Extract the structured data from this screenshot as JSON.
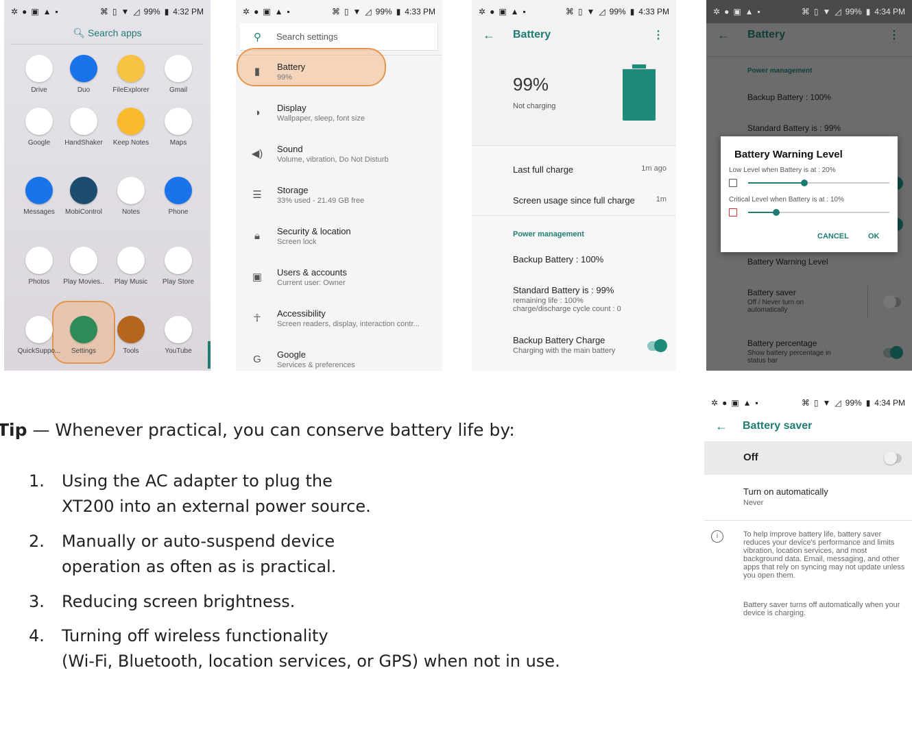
{
  "status_bars": [
    {
      "battery": "99%",
      "time": "4:32 PM"
    },
    {
      "battery": "99%",
      "time": "4:33 PM"
    },
    {
      "battery": "99%",
      "time": "4:33 PM"
    },
    {
      "battery": "99%",
      "time": "4:34 PM"
    },
    {
      "battery": "99%",
      "time": "4:34 PM"
    }
  ],
  "launcher": {
    "search_label": "Search apps",
    "rows": [
      [
        {
          "label": "Drive",
          "icon": "drive-icon",
          "color": "#ffffff"
        },
        {
          "label": "Duo",
          "icon": "duo-icon",
          "color": "#1a73e8"
        },
        {
          "label": "FileExplorer",
          "icon": "file-explorer-icon",
          "color": "#f6c343"
        },
        {
          "label": "Gmail",
          "icon": "gmail-icon",
          "color": "#ffffff"
        }
      ],
      [
        {
          "label": "Google",
          "icon": "google-icon",
          "color": "#ffffff"
        },
        {
          "label": "HandShaker",
          "icon": "handshaker-icon",
          "color": "#ffffff"
        },
        {
          "label": "Keep Notes",
          "icon": "keep-notes-icon",
          "color": "#f9bb2d"
        },
        {
          "label": "Maps",
          "icon": "maps-icon",
          "color": "#ffffff"
        }
      ],
      [
        {
          "label": "Messages",
          "icon": "messages-icon",
          "color": "#1a73e8"
        },
        {
          "label": "MobiControl",
          "icon": "mobicontrol-icon",
          "color": "#1d4d6e"
        },
        {
          "label": "Notes",
          "icon": "notes-icon",
          "color": "#ffffff"
        },
        {
          "label": "Phone",
          "icon": "phone-icon",
          "color": "#1a73e8"
        }
      ],
      [
        {
          "label": "Photos",
          "icon": "photos-icon",
          "color": "#ffffff"
        },
        {
          "label": "Play Movies..",
          "icon": "play-movies-icon",
          "color": "#ffffff"
        },
        {
          "label": "Play Music",
          "icon": "play-music-icon",
          "color": "#ffffff"
        },
        {
          "label": "Play Store",
          "icon": "play-store-icon",
          "color": "#ffffff"
        }
      ],
      [
        {
          "label": "QuickSuppo...",
          "icon": "quicksupport-icon",
          "color": "#ffffff"
        },
        {
          "label": "Settings",
          "icon": "settings-gear-icon",
          "color": "#2e8b57"
        },
        {
          "label": "Tools",
          "icon": "tools-icon",
          "color": "#b5651d"
        },
        {
          "label": "YouTube",
          "icon": "youtube-icon",
          "color": "#ffffff"
        }
      ]
    ]
  },
  "settings": {
    "search_placeholder": "Search settings",
    "items": [
      {
        "title": "Battery",
        "subtitle": "99%",
        "icon": "battery-icon"
      },
      {
        "title": "Display",
        "subtitle": "Wallpaper, sleep, font size",
        "icon": "brightness-icon"
      },
      {
        "title": "Sound",
        "subtitle": "Volume, vibration, Do Not Disturb",
        "icon": "speaker-icon"
      },
      {
        "title": "Storage",
        "subtitle": "33% used - 21.49 GB free",
        "icon": "storage-icon"
      },
      {
        "title": "Security & location",
        "subtitle": "Screen lock",
        "icon": "lock-icon"
      },
      {
        "title": "Users & accounts",
        "subtitle": "Current user: Owner",
        "icon": "account-icon"
      },
      {
        "title": "Accessibility",
        "subtitle": "Screen readers, display, interaction contr...",
        "icon": "accessibility-icon"
      },
      {
        "title": "Google",
        "subtitle": "Services & preferences",
        "icon": "google-g-icon"
      }
    ]
  },
  "battery_screen": {
    "title": "Battery",
    "percent": "99%",
    "status": "Not charging",
    "last_full_charge_label": "Last full charge",
    "last_full_charge_value": "1m ago",
    "screen_usage_label": "Screen usage since full charge",
    "screen_usage_value": "1m",
    "section": "Power management",
    "backup_battery": "Backup Battery : 100%",
    "standard_battery": "Standard Battery is : 99%",
    "remaining_life": "remaining life : 100%",
    "cycle_count": "charge/discharge cycle count : 0",
    "backup_charge_title": "Backup Battery Charge",
    "backup_charge_sub": "Charging with the main battery",
    "battery_fill_level": 0.99,
    "accent": "#1e7c73"
  },
  "warning_screen": {
    "title": "Battery",
    "section": "Power management",
    "backup_battery": "Backup Battery : 100%",
    "standard_battery": "Standard Battery is : 99%",
    "warning_level": "Battery Warning Level",
    "saver_title": "Battery saver",
    "saver_sub": "Off / Never turn on automatically",
    "percentage_title": "Battery percentage",
    "percentage_sub": "Show battery percentage in status bar",
    "dialog": {
      "title": "Battery Warning Level",
      "low_label": "Low Level when Battery is at : 20%",
      "low_value": 0.2,
      "critical_label": "Critical Level when Battery is at : 10%",
      "critical_value": 0.1,
      "cancel": "CANCEL",
      "ok": "OK"
    }
  },
  "saver_screen": {
    "title": "Battery saver",
    "state": "Off",
    "auto_title": "Turn on automatically",
    "auto_value": "Never",
    "info_1": "To help improve battery life, battery saver reduces your device's performance and limits vibration, location services, and most background data. Email, messaging, and other apps that rely on syncing may not update unless you open them.",
    "info_2": "Battery saver turns off automatically when your device is charging."
  },
  "tip": {
    "label": "Tip",
    "intro": " — Whenever practical, you can conserve battery life by:",
    "items": [
      {
        "num": "1.",
        "line1": "Using the AC adapter to plug the",
        "line2": "XT200 into an external power source."
      },
      {
        "num": "2.",
        "line1": "Manually or auto-suspend device",
        "line2": "operation as often as is practical."
      },
      {
        "num": "3.",
        "line1": "Reducing screen brightness.",
        "line2": ""
      },
      {
        "num": "4.",
        "line1": "Turning off wireless functionality",
        "line2": "(Wi-Fi, Bluetooth, location services, or GPS) when not in use."
      }
    ]
  }
}
